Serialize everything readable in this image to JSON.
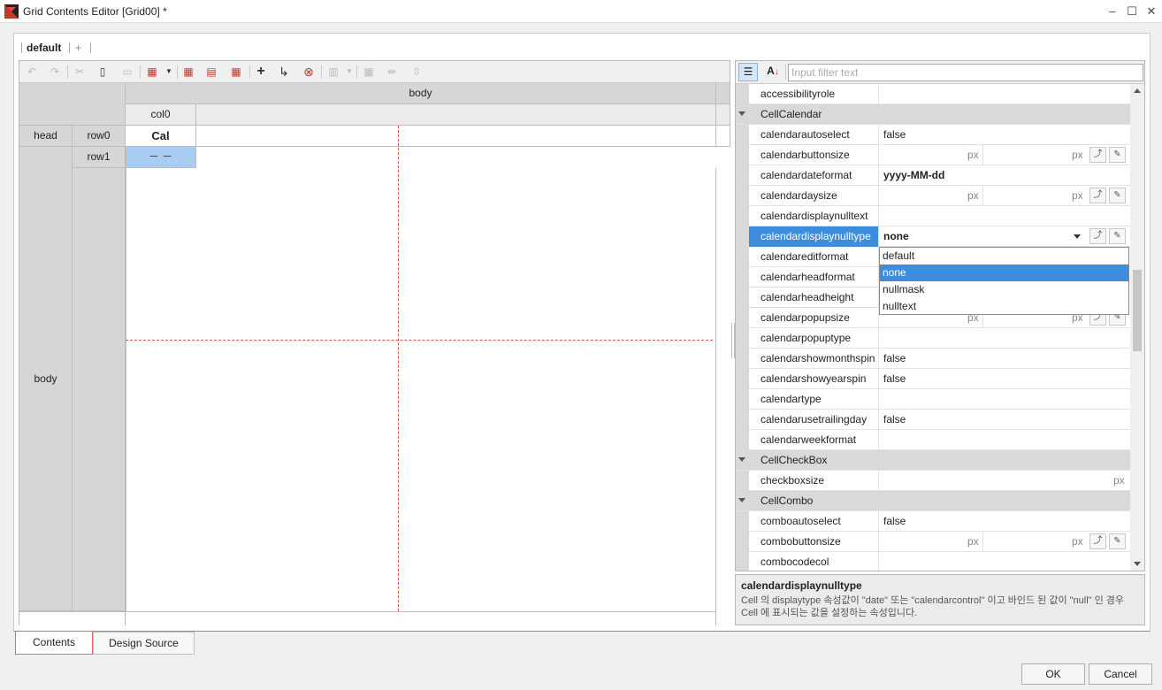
{
  "window": {
    "title": "Grid Contents Editor [Grid00] *",
    "minimize": "‒",
    "maximize": "☐",
    "close": "✕"
  },
  "format_tabs": {
    "active": "default",
    "add": "+"
  },
  "grid": {
    "band_header": "body",
    "col_header": "col0",
    "head_band": "head",
    "body_band": "body",
    "row0": "row0",
    "row1": "row1",
    "head_cell": "Cal",
    "body_cell": "－ －"
  },
  "filter": {
    "placeholder": "Input filter text",
    "value": ""
  },
  "props": {
    "accessibilityrole": {
      "name": "accessibilityrole",
      "value": ""
    },
    "cat_calendar": "CellCalendar",
    "calendarautoselect": {
      "name": "calendarautoselect",
      "value": "false"
    },
    "calendarbuttonsize": {
      "name": "calendarbuttonsize",
      "unit": "px"
    },
    "calendardateformat": {
      "name": "calendardateformat",
      "value": "yyyy-MM-dd"
    },
    "calendardaysize": {
      "name": "calendardaysize",
      "unit": "px"
    },
    "calendardisplaynulltext": {
      "name": "calendardisplaynulltext",
      "value": ""
    },
    "calendardisplaynulltype": {
      "name": "calendardisplaynulltype",
      "value": "none"
    },
    "calendareditformat": {
      "name": "calendareditformat",
      "value": ""
    },
    "calendarheadformat": {
      "name": "calendarheadformat",
      "value": ""
    },
    "calendarheadheight": {
      "name": "calendarheadheight",
      "value": ""
    },
    "calendarpopupsize": {
      "name": "calendarpopupsize",
      "unit": "px"
    },
    "calendarpopuptype": {
      "name": "calendarpopuptype",
      "value": ""
    },
    "calendarshowmonthspin": {
      "name": "calendarshowmonthspin",
      "value": "false"
    },
    "calendarshowyearspin": {
      "name": "calendarshowyearspin",
      "value": "false"
    },
    "calendartype": {
      "name": "calendartype",
      "value": ""
    },
    "calendarusetrailingday": {
      "name": "calendarusetrailingday",
      "value": "false"
    },
    "calendarweekformat": {
      "name": "calendarweekformat",
      "value": ""
    },
    "cat_checkbox": "CellCheckBox",
    "checkboxsize": {
      "name": "checkboxsize",
      "unit": "px"
    },
    "cat_combo": "CellCombo",
    "comboautoselect": {
      "name": "comboautoselect",
      "value": "false"
    },
    "combobuttonsize": {
      "name": "combobuttonsize",
      "unit": "px"
    },
    "combocodecol": {
      "name": "combocodecol",
      "value": ""
    }
  },
  "dropdown_options": [
    "default",
    "none",
    "nullmask",
    "nulltext"
  ],
  "description": {
    "title": "calendardisplaynulltype",
    "text": "Cell 의 displaytype 속성값이 \"date\" 또는 \"calendarcontrol\" 이고 바인드 된 값이 \"null\" 인 경우 Cell 에 표시되는 값을 설정하는 속성입니다."
  },
  "bottom_tabs": {
    "contents": "Contents",
    "design_source": "Design Source"
  },
  "buttons": {
    "ok": "OK",
    "cancel": "Cancel"
  },
  "toolbar_icons": [
    "undo-icon",
    "redo-icon",
    "cut-icon",
    "copy-icon",
    "paste-icon",
    "format-icon",
    "add-column-icon",
    "add-band-icon",
    "add-row-icon",
    "add-icon",
    "insert-icon",
    "delete-icon",
    "merge-icon",
    "split-icon",
    "col-size-icon",
    "row-size-icon"
  ]
}
